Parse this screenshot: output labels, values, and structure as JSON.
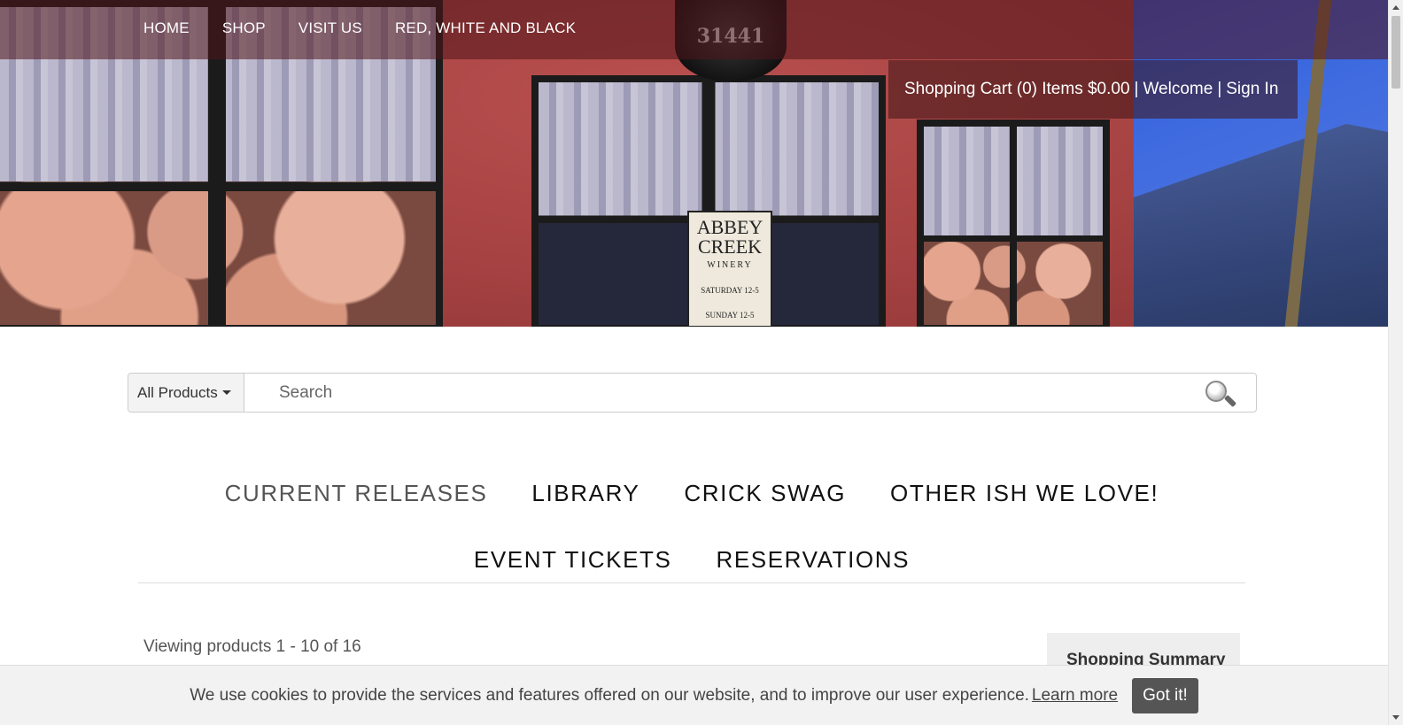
{
  "topnav": {
    "items": [
      "HOME",
      "SHOP",
      "VISIT US",
      "RED, WHITE AND BLACK"
    ]
  },
  "hero": {
    "sign_number": "31441",
    "door_sign": {
      "line1": "ABBEY",
      "line2": "CREEK",
      "line3": "WINERY",
      "hours1": "SATURDAY 12-5",
      "hours2": "SUNDAY 12-5"
    }
  },
  "cart": {
    "cart_label": "Shopping Cart (0) Items $0.00",
    "separator": "|",
    "welcome": "Welcome",
    "signin": "Sign In"
  },
  "search": {
    "category": "All Products",
    "placeholder": "Search",
    "icon": "magnifier-icon"
  },
  "categories": {
    "row1": [
      "CURRENT RELEASES",
      "LIBRARY",
      "CRICK SWAG",
      "OTHER ISH WE LOVE!"
    ],
    "row2": [
      "EVENT TICKETS",
      "RESERVATIONS"
    ],
    "active": "CURRENT RELEASES"
  },
  "content": {
    "viewing": "Viewing products 1 - 10 of 16",
    "summary_title": "Shopping Summary"
  },
  "cookie": {
    "message": "We use cookies to provide the services and features offered on our website, and to improve our user experience.",
    "learn_more": "Learn more",
    "button": "Got it!"
  }
}
